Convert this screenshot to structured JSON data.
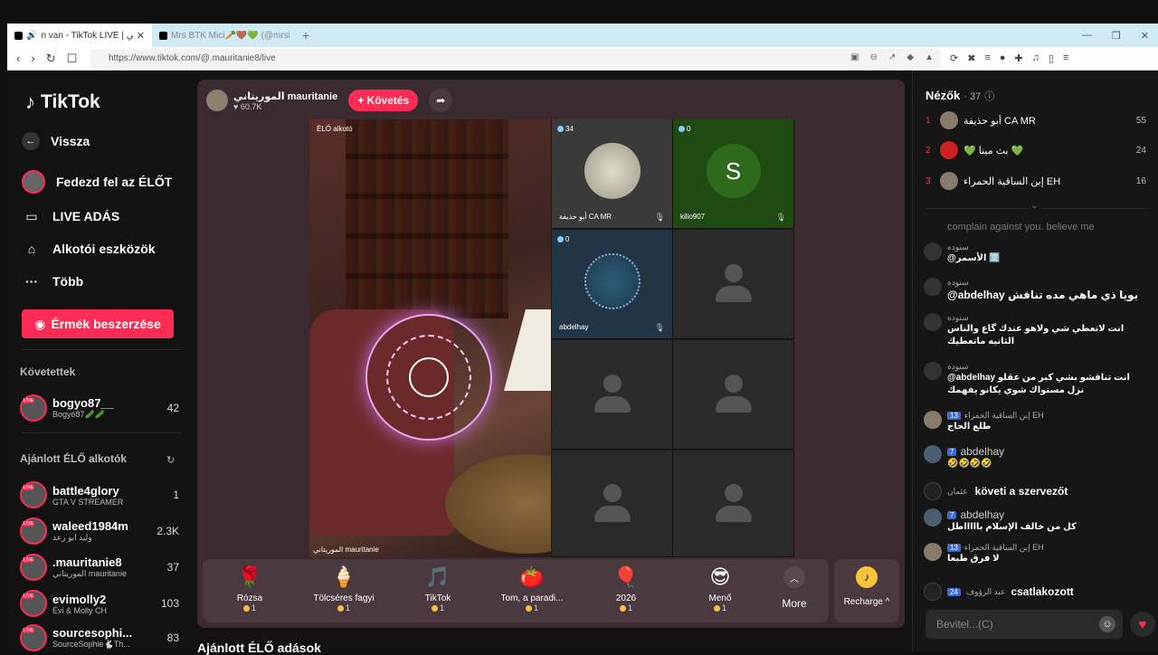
{
  "browser": {
    "tabs": [
      {
        "title": "n van - TikTok LIVE | الموريتاني",
        "active": true
      },
      {
        "title": "Mrs BTK Mici🥕🤎💚 (@mrsbtk) |",
        "active": false
      }
    ],
    "url": "https://www.tiktok.com/@.mauritanie8/live"
  },
  "sidebar": {
    "logo": "TikTok",
    "nav": [
      {
        "label": "Vissza",
        "icon": "back-arrow-icon"
      },
      {
        "label": "Fedezd fel az ÉLŐT",
        "icon": "explore-live-icon"
      },
      {
        "label": "LIVE ADÁS",
        "icon": "camera-icon"
      },
      {
        "label": "Alkotói eszközök",
        "icon": "creator-tools-icon"
      },
      {
        "label": "Több",
        "icon": "more-dots-icon"
      }
    ],
    "coin_button": "Érmék beszerzése",
    "following_title": "Követettek",
    "following": [
      {
        "name": "bogyo87__",
        "sub": "Bogyó87🥒🥒",
        "count": "42"
      }
    ],
    "recommended_title": "Ajánlott ÉLŐ alkotók",
    "recommended": [
      {
        "name": "battle4glory",
        "sub": "GTA V STREAMER",
        "count": "1"
      },
      {
        "name": "waleed1984m",
        "sub": "وليد ابو رعد",
        "count": "2.3K"
      },
      {
        "name": ".mauritanie8",
        "sub": "الموريتاني mauritanie",
        "count": "37"
      },
      {
        "name": "evimolly2",
        "sub": "Évi & Molly CH",
        "count": "103"
      },
      {
        "name": "sourcesophi...",
        "sub": "SourceSophie🐇Th...",
        "count": "83"
      }
    ]
  },
  "stream": {
    "host_name": "الموريتاني mauritanie",
    "host_likes": "60.7K",
    "follow_label": "+ Követés",
    "video_tag": "ÉLŐ alkotó",
    "video_footer": "الموريتاني mauritanie",
    "guests": [
      {
        "viewers": "34",
        "name": "أبو حذيفة CA MR",
        "type": "moon"
      },
      {
        "viewers": "0",
        "name": "kilio907",
        "type": "letter",
        "letter": "S"
      },
      {
        "viewers": "0",
        "name": "abdelhay",
        "type": "seal"
      }
    ],
    "gifts": [
      {
        "name": "Rózsa",
        "price": "1",
        "icon": "🌹"
      },
      {
        "name": "Tölcséres fagyi",
        "price": "1",
        "icon": "🍦"
      },
      {
        "name": "TikTok",
        "price": "1",
        "icon": "🎵"
      },
      {
        "name": "Tom, a paradi...",
        "price": "1",
        "icon": "🍅"
      },
      {
        "name": "2026",
        "price": "1",
        "icon": "🎈"
      },
      {
        "name": "Menő",
        "price": "1",
        "icon": "😎"
      }
    ],
    "more_label": "More",
    "recharge_label": "Recharge ^"
  },
  "recommended_lives_title": "Ajánlott ÉLŐ adások",
  "chat": {
    "viewers_title": "Nézők",
    "viewers_count": "· 37",
    "ranking": [
      {
        "rank": "1",
        "name": "أبو حذيفة CA MR",
        "score": "55"
      },
      {
        "rank": "2",
        "name": "💚 بث مينا 💚",
        "score": "24"
      },
      {
        "rank": "3",
        "name": "إبن الساقية الحمراء EH",
        "score": "16"
      }
    ],
    "faded_line": "complain against you. believe me",
    "messages": [
      {
        "user": "سنوده",
        "text": "@الأسمر 🈳",
        "badge": ""
      },
      {
        "user": "سنوده",
        "text": "@abdelhay بويا ذي ماهي مده تناقش",
        "badge": ""
      },
      {
        "user": "سنوده",
        "text": "انت لاتعطي شي ولاهو عندك گاع والناس الثانيه ماتعطيك",
        "badge": ""
      },
      {
        "user": "سنوده",
        "text": "@abdelhay انت تناقشو بشي كبر من عقلو نزل مستواك شوي يكانو يفهمك",
        "badge": ""
      },
      {
        "user": "إبن الساقية الحمراء EH",
        "text": "طلع الحاج",
        "badge": "13"
      },
      {
        "user": "abdelhay",
        "text": "🤣🤣🤣🤣",
        "badge": "7"
      },
      {
        "user": "عثمان",
        "text": "követi a szervezőt",
        "badge": ""
      },
      {
        "user": "abdelhay",
        "text": "كل من خالف الإسلام باااااطل",
        "badge": "7"
      },
      {
        "user": "إبن الساقية الحمراء EH",
        "text": "لا فرق طبعا",
        "badge": "13"
      },
      {
        "user": "عبد الرؤوف",
        "text": "csatlakozott",
        "badge": "24"
      }
    ],
    "input_placeholder": "Bevitel...(C)"
  }
}
